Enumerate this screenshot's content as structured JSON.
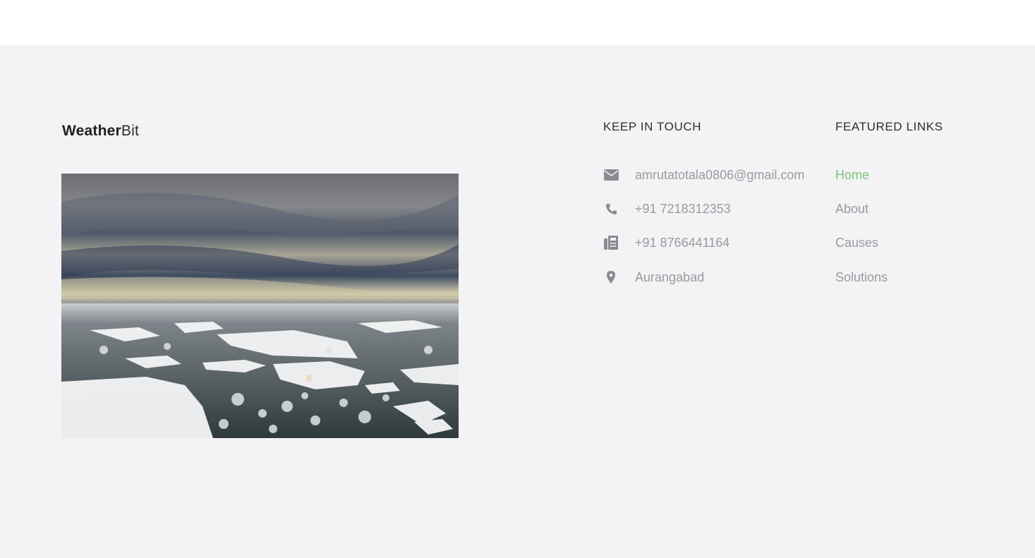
{
  "brand": {
    "bold": "Weather",
    "light": "Bit"
  },
  "contact": {
    "title": "KEEP IN TOUCH",
    "items": [
      {
        "icon": "envelope-icon",
        "text": "amrutatotala0806@gmail.com"
      },
      {
        "icon": "phone-icon",
        "text": "+91 7218312353"
      },
      {
        "icon": "fax-icon",
        "text": "+91 8766441164"
      },
      {
        "icon": "map-marker-icon",
        "text": "Aurangabad"
      }
    ]
  },
  "links": {
    "title": "FEATURED LINKS",
    "items": [
      {
        "label": "Home"
      },
      {
        "label": "About"
      },
      {
        "label": "Causes"
      },
      {
        "label": "Solutions"
      }
    ]
  },
  "colors": {
    "background": "#f3f3f5",
    "text_muted": "#9a9aa0",
    "link_active": "#7dc47d",
    "icon": "#8a8a90"
  }
}
